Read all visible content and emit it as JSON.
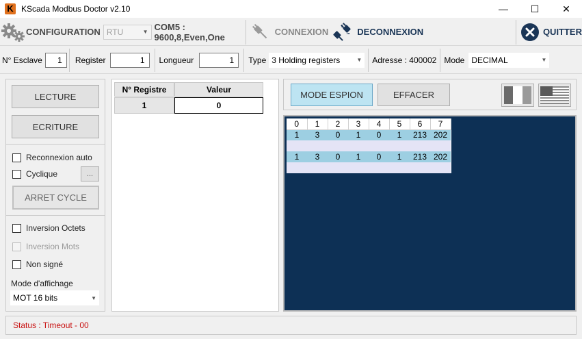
{
  "window": {
    "title": "KScada Modbus Doctor v2.10",
    "icon_letter": "K"
  },
  "toolbar": {
    "configuration_label": "CONFIGURATION",
    "protocol_value": "RTU",
    "com_settings": "COM5 : 9600,8,Even,One",
    "connexion_label": "CONNEXION",
    "deconnexion_label": "DECONNEXION",
    "quitter_label": "QUITTER"
  },
  "params": {
    "slave_label": "N° Esclave",
    "slave_value": "1",
    "register_label": "Register",
    "register_value": "1",
    "length_label": "Longueur",
    "length_value": "1",
    "type_label": "Type",
    "type_value": "3 Holding registers",
    "address_text": "Adresse : 400002",
    "mode_label": "Mode",
    "mode_value": "DECIMAL"
  },
  "left": {
    "read_label": "LECTURE",
    "write_label": "ECRITURE",
    "reconnect_label": "Reconnexion auto",
    "cyclic_label": "Cyclique",
    "cyclic_more": "...",
    "stop_cycle_label": "ARRET CYCLE",
    "invert_bytes_label": "Inversion Octets",
    "invert_words_label": "Inversion Mots",
    "unsigned_label": "Non signé",
    "display_mode_label": "Mode d'affichage",
    "display_mode_value": "MOT 16 bits"
  },
  "register_grid": {
    "headers": [
      "N° Registre",
      "Valeur"
    ],
    "rows": [
      {
        "register": "1",
        "value": "0"
      }
    ]
  },
  "spy": {
    "spy_label": "MODE ESPION",
    "clear_label": "EFFACER",
    "flag_fr": "french-flag-icon",
    "flag_us": "us-flag-icon",
    "columns": [
      "0",
      "1",
      "2",
      "3",
      "4",
      "5",
      "6",
      "7"
    ],
    "frames": [
      [
        "1",
        "3",
        "0",
        "1",
        "0",
        "1",
        "213",
        "202"
      ],
      [
        "1",
        "3",
        "0",
        "1",
        "0",
        "1",
        "213",
        "202"
      ]
    ]
  },
  "status": {
    "text": "Status : Timeout - 00"
  },
  "colors": {
    "status_text": "#c81010",
    "spy_background": "#0d3055",
    "spy_row": "#9dcfe2",
    "spy_button": "#bde4f2"
  }
}
